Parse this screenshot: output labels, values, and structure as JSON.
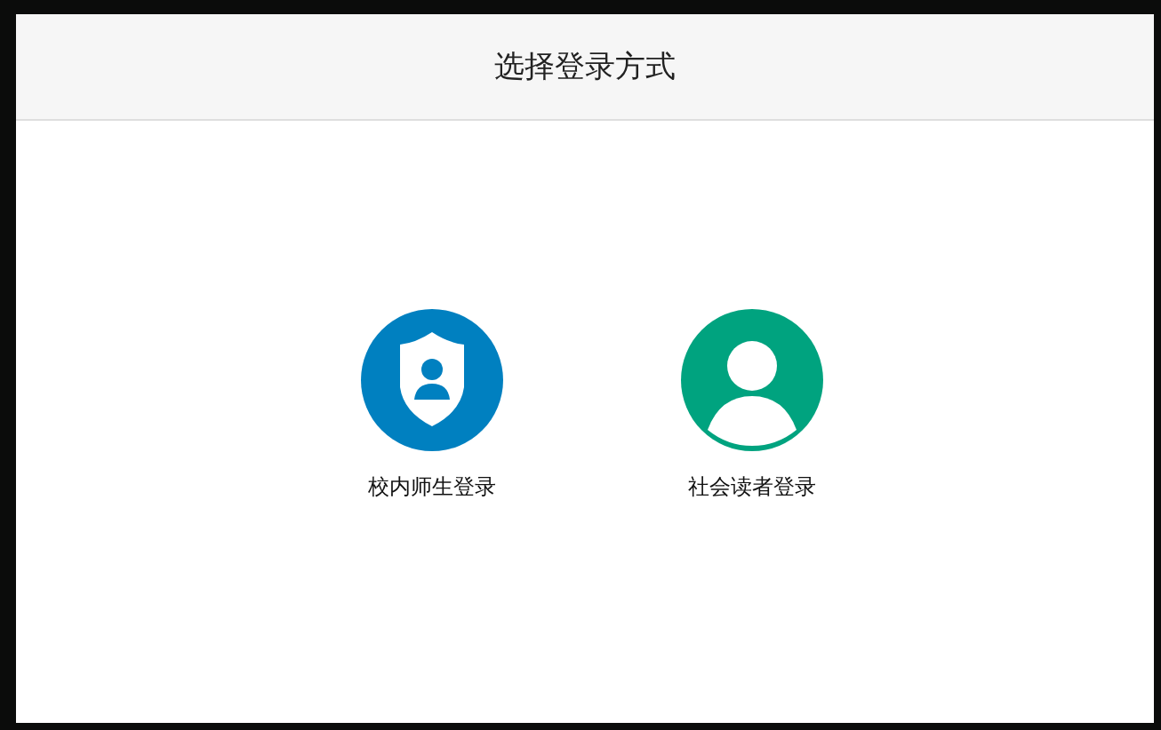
{
  "dialog": {
    "title": "选择登录方式"
  },
  "options": [
    {
      "kind": "shield",
      "label": "校内师生登录",
      "color": "#0080c0"
    },
    {
      "kind": "person",
      "label": "社会读者登录",
      "color": "#00a37f"
    }
  ]
}
